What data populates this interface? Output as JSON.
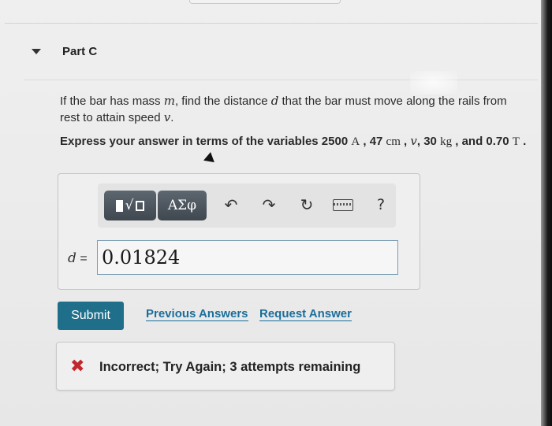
{
  "part": {
    "title": "Part C"
  },
  "question": {
    "text_before_m": "If the bar has mass ",
    "var_m": "m",
    "text_before_d": ", find the distance ",
    "var_d": "d",
    "text_after_d": " that the bar must move along the rails from rest to attain speed ",
    "var_v": "v",
    "end": "."
  },
  "instruction": {
    "prefix": "Express your answer in terms of the variables 2500 ",
    "unit_A": "A",
    "mid1": " , 47 ",
    "unit_cm": "cm",
    "mid2": " , ",
    "var_v": "v",
    "mid3": ", 30 ",
    "unit_kg": "kg",
    "mid4": " , and 0.70 ",
    "unit_T": "T",
    "end": " ."
  },
  "toolbar": {
    "templates_label": "√",
    "symbols_label": "ΑΣφ",
    "undo_glyph": "↶",
    "redo_glyph": "↷",
    "reset_glyph": "↻",
    "help_label": "?"
  },
  "answer": {
    "variable": "d",
    "equals": "=",
    "value": "0.01824"
  },
  "actions": {
    "submit_label": "Submit",
    "previous_answers_label": "Previous Answers",
    "request_answer_label": "Request Answer"
  },
  "feedback": {
    "icon_glyph": "✖",
    "message": "Incorrect; Try Again; 3 attempts remaining",
    "status_color": "#c0272d"
  },
  "colors": {
    "accent": "#1f6f8b",
    "link": "#1a6e9a"
  }
}
